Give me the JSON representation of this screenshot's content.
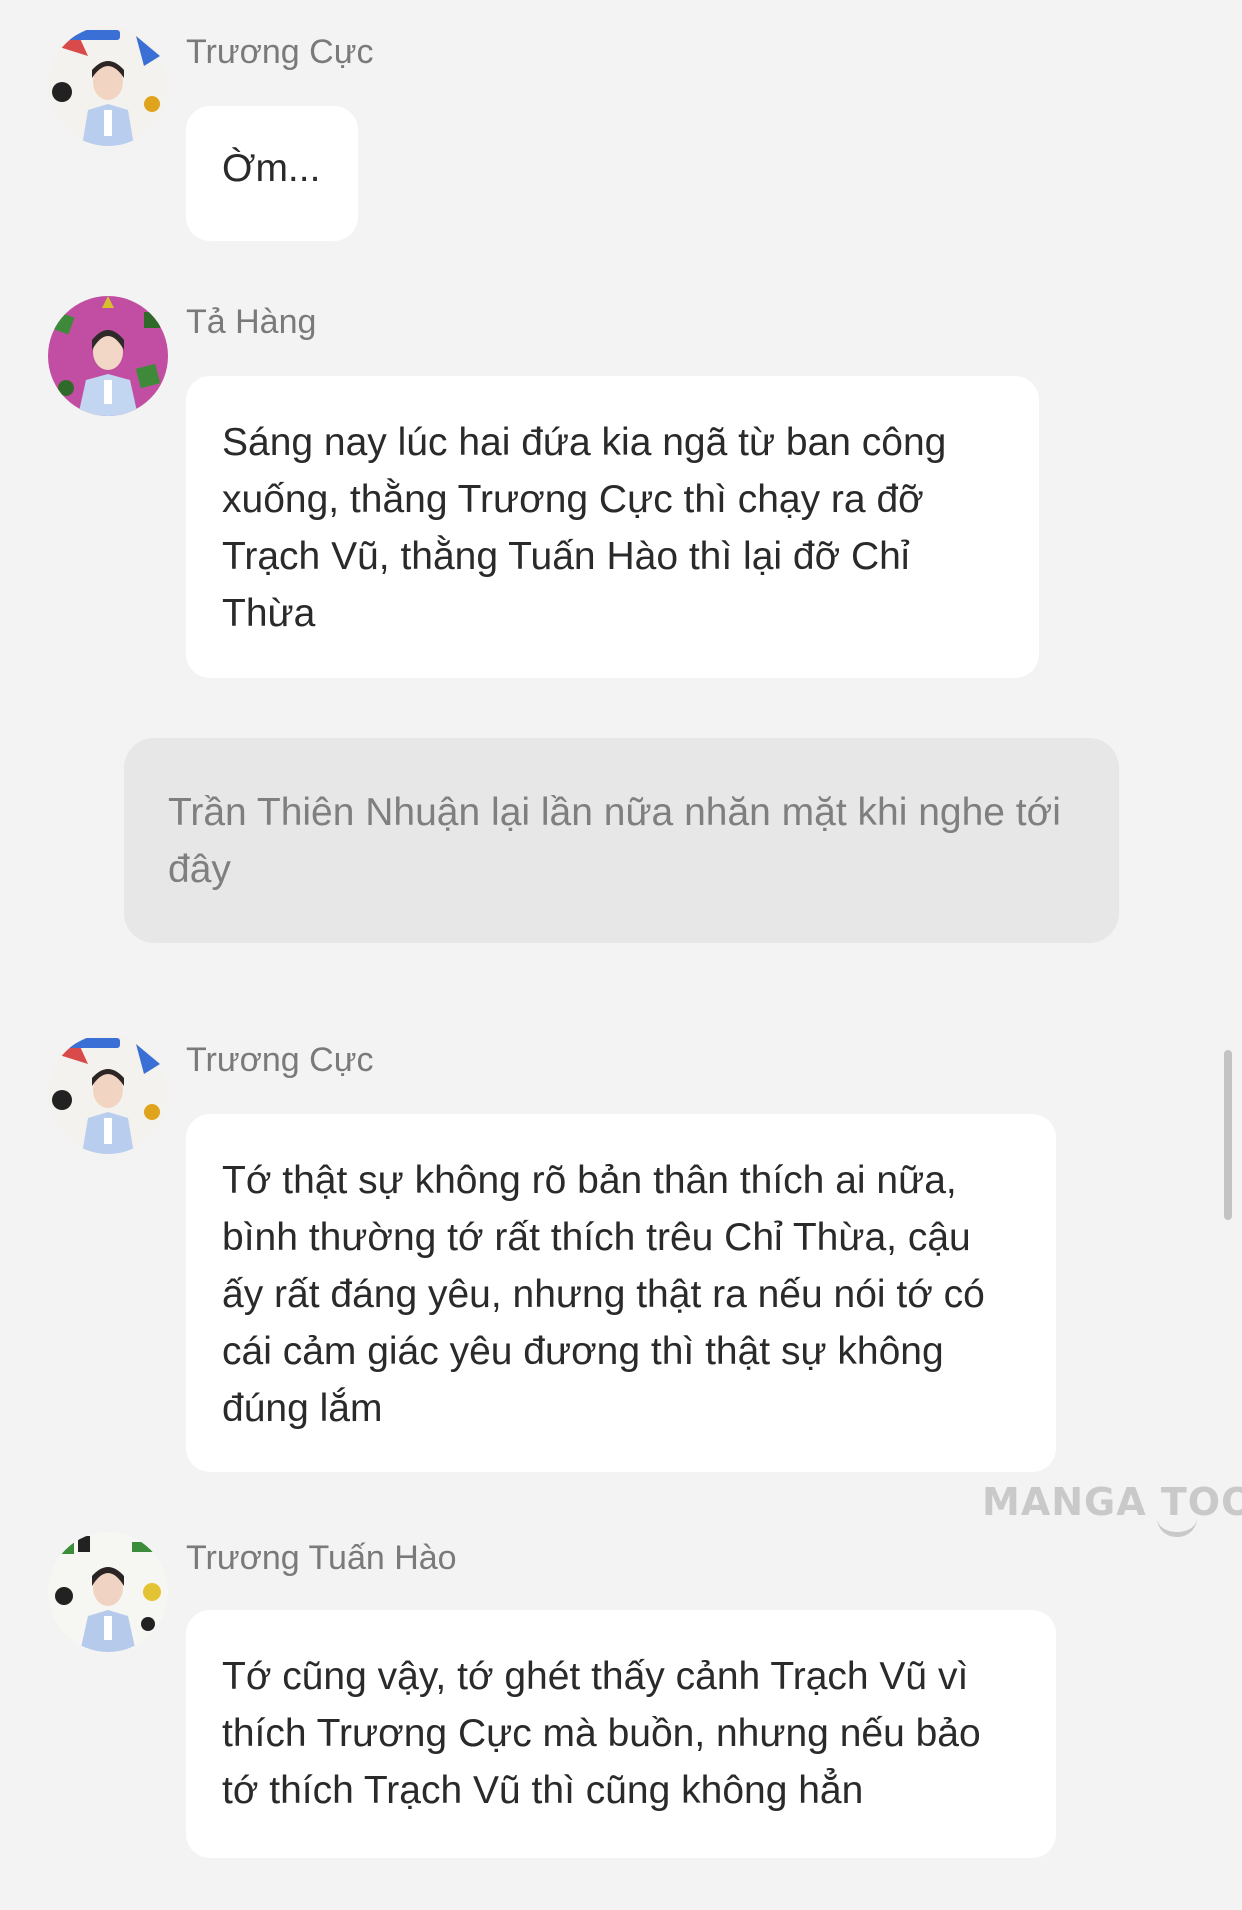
{
  "messages": [
    {
      "sender": "Trương Cực",
      "avatar_icon": "avatar-truong-cuc",
      "text": "Ờm..."
    },
    {
      "sender": "Tả Hàng",
      "avatar_icon": "avatar-ta-hang",
      "text": "Sáng nay lúc hai đứa kia ngã từ ban công xuống, thằng Trương Cực thì chạy ra đỡ Trạch Vũ, thằng Tuấn Hào thì lại đỡ Chỉ Thừa"
    },
    {
      "sender": "Trương Cực",
      "avatar_icon": "avatar-truong-cuc",
      "text": "Tớ thật sự không rõ bản thân thích ai nữa, bình thường tớ rất thích trêu Chỉ Thừa, cậu ấy rất đáng yêu, nhưng thật ra nếu nói tớ có cái cảm giác yêu đương thì thật sự không đúng lắm"
    },
    {
      "sender": "Trương Tuấn Hào",
      "avatar_icon": "avatar-truong-tuan-hao",
      "text": "Tớ cũng vậy, tớ ghét thấy cảnh Trạch Vũ vì thích Trương Cực mà buồn, nhưng nếu bảo tớ thích Trạch Vũ thì cũng không hẳn"
    }
  ],
  "narration": {
    "text": "Trần Thiên Nhuận lại lần nữa nhăn mặt khi nghe tới đây"
  },
  "watermark": {
    "text": "MANGA TOON"
  },
  "colors": {
    "background": "#f3f3f3",
    "bubble": "#ffffff",
    "narration_bg": "#e7e7e7",
    "sender_name": "#7a7a7a",
    "message_text": "#2a2a2a",
    "narration_text": "#7f7f7f"
  }
}
